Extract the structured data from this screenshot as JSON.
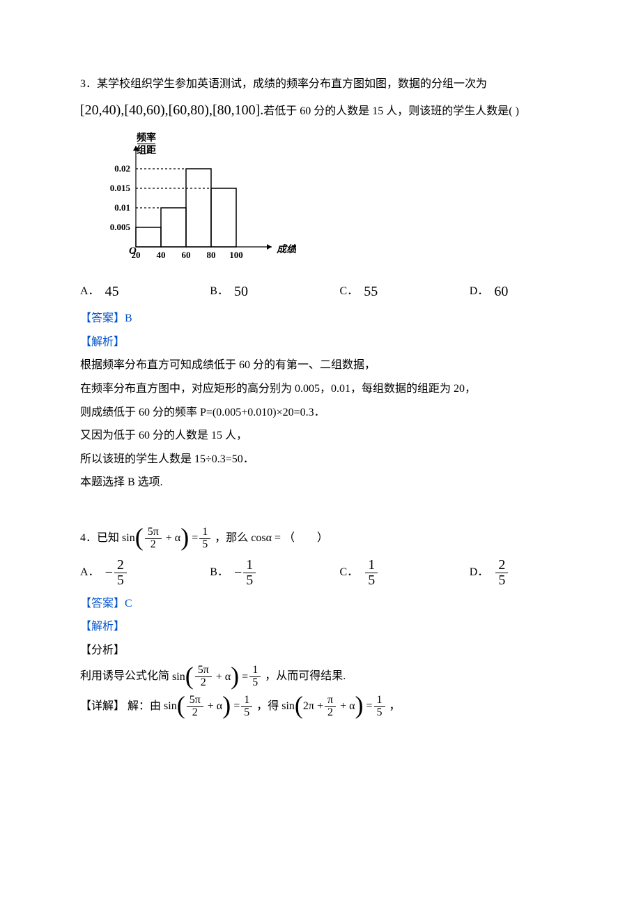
{
  "q3": {
    "number": "3．",
    "text1": "某学校组织学生参加英语测试，成绩的频率分布直方图如图，数据的分组一次为",
    "intervals": "[20,40),[40,60),[60,80),[80,100].",
    "text2": "若低于 60 分的人数是 15 人，则该班的学生人数是(  )",
    "options": {
      "a_label": "A．",
      "a_val": "45",
      "b_label": "B．",
      "b_val": "50",
      "c_label": "C．",
      "c_val": "55",
      "d_label": "D．",
      "d_val": "60"
    },
    "answer_label": "【答案】",
    "answer_val": "B",
    "analysis_label": "【解析】",
    "sol1": "根据频率分布直方可知成绩低于 60 分的有第一、二组数据，",
    "sol2": "在频率分布直方图中，对应矩形的高分别为 0.005，0.01，每组数据的组距为 20，",
    "sol3": "则成绩低于 60 分的频率 P=(0.005+0.010)×20=0.3．",
    "sol4": "又因为低于 60 分的人数是 15 人，",
    "sol5": "所以该班的学生人数是 15÷0.3=50．",
    "sol6": "本题选择 B 选项."
  },
  "q4": {
    "number": "4．",
    "pre": "已知",
    "post": "，那么",
    "tail": "（　　）",
    "cos": "cosα =",
    "options": {
      "a_label": "A．",
      "b_label": "B．",
      "c_label": "C．",
      "d_label": "D．"
    },
    "answer_label": "【答案】",
    "answer_val": "C",
    "analysis_label": "【解析】",
    "fx_label": "【分析】",
    "fx_pre": "利用诱导公式化简",
    "fx_post": "，从而可得结果.",
    "detail_label": "【详解】",
    "detail_by": "解：由",
    "detail_get": "，得",
    "comma": "，"
  },
  "chart": {
    "ylabel1": "频率",
    "ylabel2": "组距",
    "xlabel": "成绩/分",
    "origin": "O",
    "xticks": [
      "20",
      "40",
      "60",
      "80",
      "100"
    ],
    "yticks": [
      "0.005",
      "0.01",
      "0.015",
      "0.02"
    ]
  },
  "chart_data": {
    "type": "bar",
    "categories": [
      20,
      40,
      60,
      80,
      100
    ],
    "bin_width": 20,
    "values": [
      0.005,
      0.01,
      0.02,
      0.015
    ],
    "xlabel": "成绩/分",
    "ylabel": "频率/组距",
    "xlim": [
      20,
      100
    ],
    "ylim": [
      0,
      0.02
    ]
  }
}
